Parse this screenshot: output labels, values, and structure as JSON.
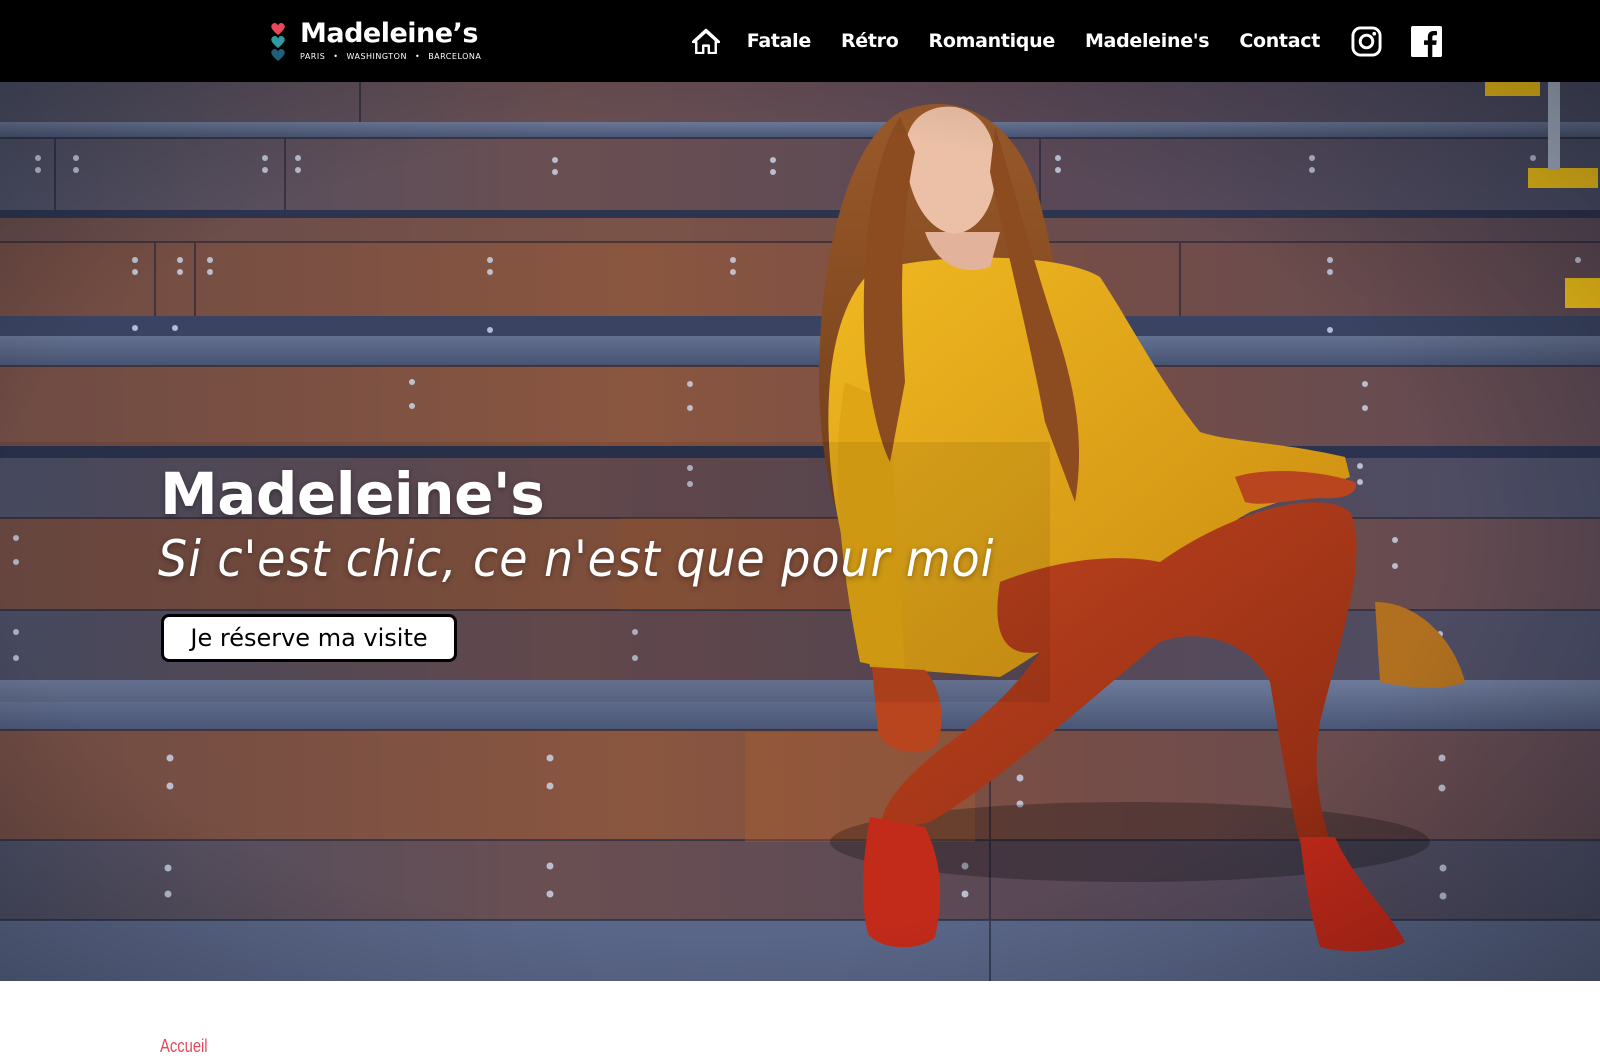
{
  "header": {
    "logo": {
      "name": "Madeleine’s",
      "cities": [
        "PARIS",
        "WASHINGTON",
        "BARCELONA"
      ],
      "separator": "•",
      "heart_colors": [
        "#e8485a",
        "#2f9aa0",
        "#1e5f7a"
      ]
    },
    "nav": {
      "home_icon": "home-icon",
      "items": [
        "Fatale",
        "Rétro",
        "Romantique",
        "Madeleine's",
        "Contact"
      ],
      "social": [
        "instagram-icon",
        "facebook-icon"
      ]
    }
  },
  "hero": {
    "title": "Madeleine's",
    "tagline": "Si c'est chic, ce n'est que pour moi",
    "cta_label": "Je réserve ma visite"
  },
  "breadcrumb": {
    "home": "Accueil"
  },
  "colors": {
    "header_bg": "#000000",
    "accent": "#e8485a",
    "text_light": "#ffffff"
  }
}
